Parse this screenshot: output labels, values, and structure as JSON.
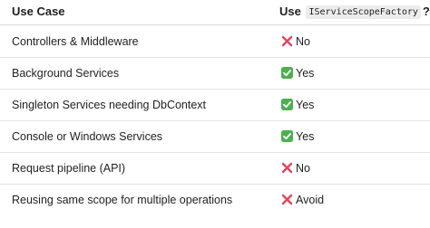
{
  "header": {
    "col1": "Use Case",
    "col2_prefix": "Use",
    "col2_code": "IServiceScopeFactory",
    "col2_suffix": "?"
  },
  "rows": [
    {
      "use_case": "Controllers & Middleware",
      "answer": "No",
      "icon": "cross-mark-icon"
    },
    {
      "use_case": "Background Services",
      "answer": "Yes",
      "icon": "check-mark-icon"
    },
    {
      "use_case": "Singleton Services needing DbContext",
      "answer": "Yes",
      "icon": "check-mark-icon"
    },
    {
      "use_case": "Console or Windows Services",
      "answer": "Yes",
      "icon": "check-mark-icon"
    },
    {
      "use_case": "Request pipeline (API)",
      "answer": "No",
      "icon": "cross-mark-icon"
    },
    {
      "use_case": "Reusing same scope for multiple operations",
      "answer": "Avoid",
      "icon": "cross-mark-icon"
    }
  ],
  "colors": {
    "cross": "#e0455a",
    "check": "#4caf50"
  }
}
